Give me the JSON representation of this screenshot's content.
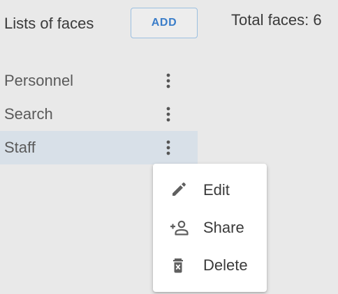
{
  "header": {
    "title": "Lists of faces",
    "add_button_label": "ADD",
    "total_faces": "Total faces: 6"
  },
  "lists": [
    {
      "label": "Personnel",
      "selected": false
    },
    {
      "label": "Search",
      "selected": false
    },
    {
      "label": "Staff",
      "selected": true
    }
  ],
  "context_menu": {
    "items": [
      {
        "label": "Edit",
        "icon": "pencil-icon"
      },
      {
        "label": "Share",
        "icon": "person-add-icon"
      },
      {
        "label": "Delete",
        "icon": "trash-icon"
      }
    ]
  },
  "colors": {
    "accent": "#3a7dc9",
    "selected_row": "#d8e0e8",
    "background": "#e9e9e9"
  }
}
